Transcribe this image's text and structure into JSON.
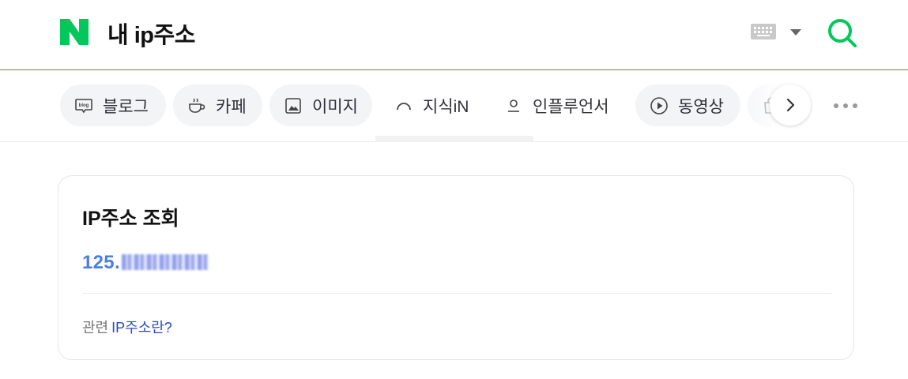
{
  "header": {
    "query": "내 ip주소",
    "brand_color": "#03c75a",
    "icons": [
      "naver-logo",
      "keyboard-icon",
      "caret-down-icon",
      "search-icon"
    ]
  },
  "tabs": [
    {
      "label": "블로그",
      "icon": "blog-icon"
    },
    {
      "label": "카페",
      "icon": "cafe-icon"
    },
    {
      "label": "이미지",
      "icon": "image-icon"
    },
    {
      "label": "지식iN",
      "icon": "kin-icon"
    },
    {
      "label": "인플루언서",
      "icon": "influencer-icon"
    },
    {
      "label": "동영상",
      "icon": "video-icon"
    },
    {
      "label": "",
      "icon": "shopping-icon"
    }
  ],
  "card": {
    "title": "IP주소 조회",
    "ip_prefix": "125.",
    "ip_color": "#4a7fe0",
    "related_prefix": "관련",
    "related_link": "IP주소란?"
  }
}
